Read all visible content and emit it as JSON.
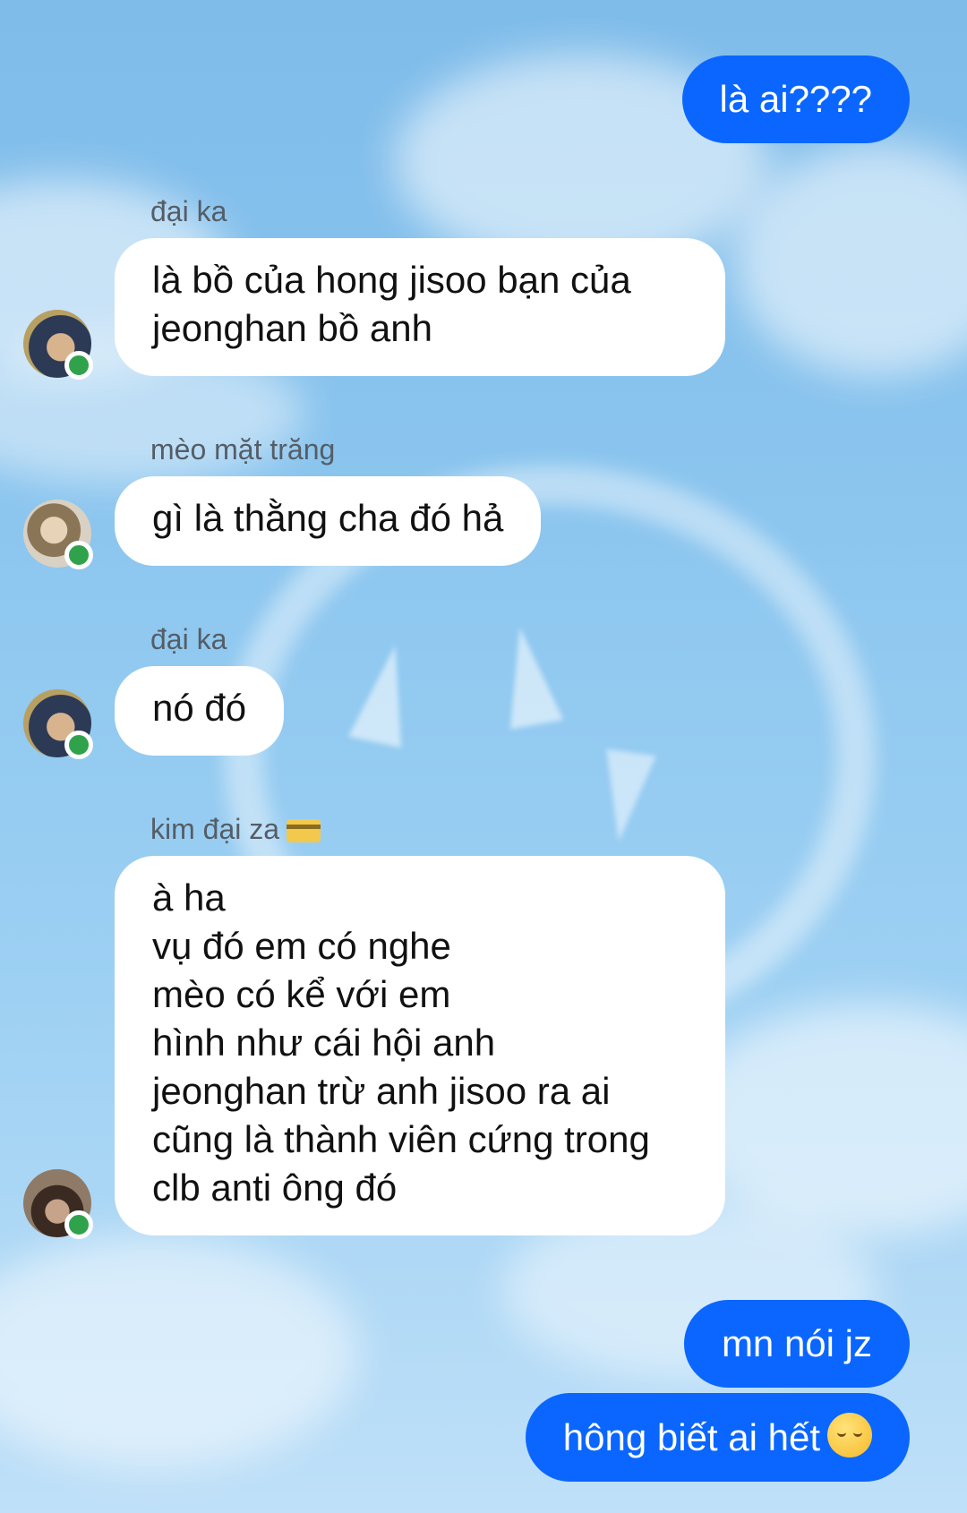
{
  "colors": {
    "outgoing_bubble": "#0a66ff",
    "incoming_bubble": "#ffffff",
    "online_indicator": "#31a24c",
    "background_sky": "#8cc6ef"
  },
  "messages": {
    "out1": "là ai????",
    "group1": {
      "sender": "đại ka",
      "lines": [
        "là bồ của hong jisoo bạn của",
        "jeonghan bồ anh"
      ]
    },
    "group2": {
      "sender": "mèo mặt trăng",
      "lines": [
        "gì là thằng cha đó hả"
      ]
    },
    "group3": {
      "sender": "đại ka",
      "lines": [
        "nó đó"
      ]
    },
    "group4": {
      "sender": "kim đại za",
      "sender_icon": "credit-card-icon",
      "lines": [
        "à ha",
        "vụ đó em có nghe",
        "mèo có kể với em",
        "hình như cái hội anh",
        "jeonghan trừ anh jisoo ra ai",
        "cũng là thành viên cứng trong",
        "clb anti ông đó"
      ]
    },
    "out2": "mn nói jz",
    "out3": "hông biết ai hết",
    "out3_emoji": "pensive-face-emoji"
  }
}
